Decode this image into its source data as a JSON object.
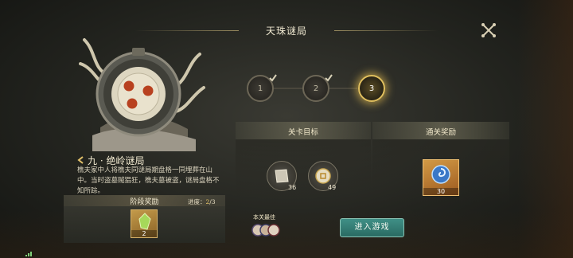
{
  "header": {
    "title": "天珠谜局",
    "close_icon": "crossed-swords-close-icon"
  },
  "level": {
    "title": "九 · 绝岭谜局",
    "description": "樵夫家中人将樵夫同谜局期盘格一同埋葬在山中。当时盗墓贼猖狂，樵夫墓被盗，谜局盘格不知所踪。"
  },
  "stage_rewards": {
    "title": "阶段奖励",
    "progress_label": "进度：",
    "progress_current": "2",
    "progress_total": "/3",
    "items": [
      {
        "icon": "green-crystal-icon",
        "count": "2"
      }
    ]
  },
  "stages": [
    {
      "label": "1",
      "completed": true
    },
    {
      "label": "2",
      "completed": true
    },
    {
      "label": "3",
      "current": true
    }
  ],
  "objectives": {
    "title": "关卡目标",
    "items": [
      {
        "icon": "stone-block-icon",
        "count": "36"
      },
      {
        "icon": "gold-coin-icon",
        "count": "49"
      }
    ]
  },
  "clear_rewards": {
    "title": "通关奖励",
    "items": [
      {
        "icon": "blue-swirl-icon",
        "count": "30"
      }
    ]
  },
  "best": {
    "label": "本关最佳"
  },
  "actions": {
    "enter_label": "进入游戏"
  },
  "colors": {
    "accent_gold": "#e0bf5e",
    "button_teal": "#2f7d74"
  }
}
